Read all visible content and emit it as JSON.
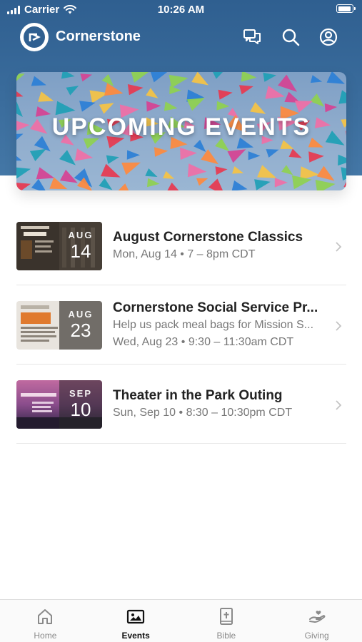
{
  "status_bar": {
    "carrier": "Carrier",
    "time": "10:26 AM"
  },
  "header": {
    "app_title": "Cornerstone",
    "icons": [
      "chat-icon",
      "search-icon",
      "profile-icon"
    ]
  },
  "banner": {
    "title": "UPCOMING EVENTS"
  },
  "events": [
    {
      "title": "August Cornerstone Classics",
      "lines": [
        "Mon, Aug 14 • 7 – 8pm CDT"
      ],
      "month": "AUG",
      "day": "14"
    },
    {
      "title": "Cornerstone Social Service Pr...",
      "lines": [
        "Help us pack meal bags for Mission S...",
        "Wed, Aug 23 • 9:30 – 11:30am CDT"
      ],
      "month": "AUG",
      "day": "23"
    },
    {
      "title": "Theater in the Park Outing",
      "lines": [
        "Sun, Sep 10 • 8:30 – 10:30pm CDT"
      ],
      "month": "SEP",
      "day": "10"
    }
  ],
  "tabs": [
    {
      "label": "Home",
      "icon": "home-icon",
      "active": false
    },
    {
      "label": "Events",
      "icon": "events-icon",
      "active": true
    },
    {
      "label": "Bible",
      "icon": "bible-icon",
      "active": false
    },
    {
      "label": "Giving",
      "icon": "giving-icon",
      "active": false
    }
  ],
  "colors": {
    "header_blue": "#3a6c9c",
    "active_tab": "#111111",
    "inactive_tab": "#8a8a8a"
  }
}
